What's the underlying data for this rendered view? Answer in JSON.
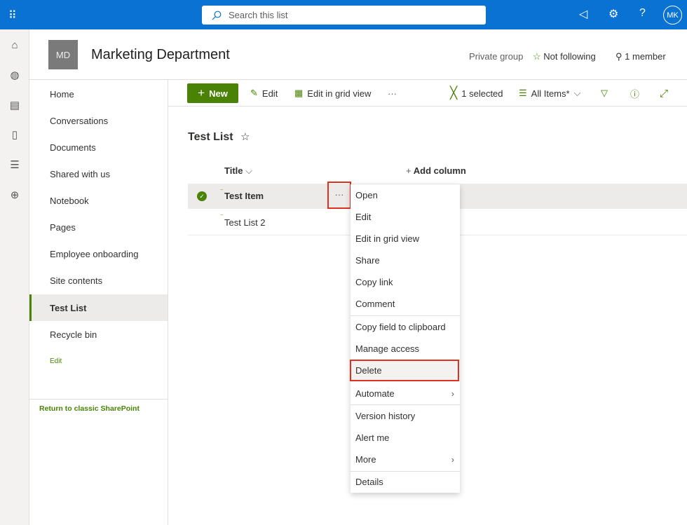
{
  "topbar": {
    "search_placeholder": "Search this list",
    "avatar": "MK",
    "icons": [
      "app-launcher-icon",
      "megaphone-icon",
      "gear-icon",
      "help-icon"
    ]
  },
  "header": {
    "logo": "MD",
    "title": "Marketing Department",
    "privacy": "Private group",
    "follow": "Not following",
    "members": "1 member"
  },
  "rail": {
    "icons": [
      "home-icon",
      "globe-icon",
      "news-icon",
      "document-icon",
      "list-icon",
      "add-icon"
    ]
  },
  "nav": {
    "items": [
      {
        "label": "Home"
      },
      {
        "label": "Conversations"
      },
      {
        "label": "Documents"
      },
      {
        "label": "Shared with us"
      },
      {
        "label": "Notebook"
      },
      {
        "label": "Pages"
      },
      {
        "label": "Employee onboarding"
      },
      {
        "label": "Site contents"
      },
      {
        "label": "Test List",
        "selected": true
      },
      {
        "label": "Recycle bin"
      }
    ],
    "edit": "Edit",
    "classic": "Return to classic SharePoint"
  },
  "cmdbar": {
    "new": "New",
    "edit": "Edit",
    "grid": "Edit in grid view",
    "more": "···",
    "selected": "1 selected",
    "view": "All Items*"
  },
  "list": {
    "title": "Test List",
    "column": "Title",
    "add_column": "Add column",
    "rows": [
      {
        "title": "Test Item",
        "selected": true
      },
      {
        "title": "Test List 2",
        "selected": false
      }
    ]
  },
  "menu": {
    "items": [
      {
        "label": "Open"
      },
      {
        "label": "Edit"
      },
      {
        "label": "Edit in grid view"
      },
      {
        "label": "Share"
      },
      {
        "label": "Copy link"
      },
      {
        "label": "Comment"
      },
      {
        "label": "Copy field to clipboard"
      },
      {
        "label": "Manage access"
      },
      {
        "label": "Delete",
        "highlighted": true
      },
      {
        "label": "Automate",
        "submenu": true
      },
      {
        "label": "Version history"
      },
      {
        "label": "Alert me"
      },
      {
        "label": "More",
        "submenu": true
      },
      {
        "label": "Details"
      }
    ]
  },
  "colors": {
    "brand": "#0a72d2",
    "accent": "#498205",
    "highlight": "#e0301e"
  }
}
